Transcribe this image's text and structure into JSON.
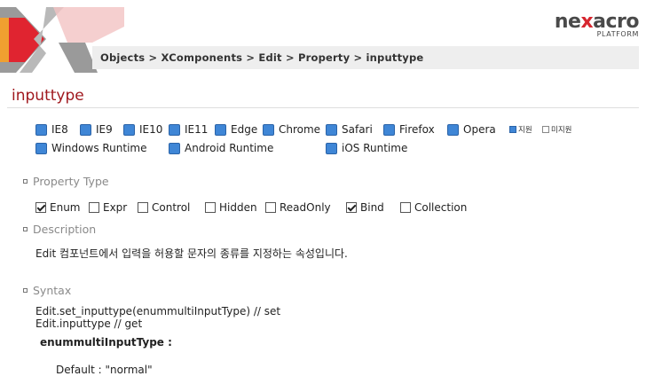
{
  "header": {
    "breadcrumb": "Objects > XComponents > Edit > Property > inputtype",
    "brand_pre": "ne",
    "brand_x": "x",
    "brand_post": "acro",
    "brand_sub": "PLATFORM"
  },
  "page": {
    "title": "inputtype"
  },
  "environments": {
    "row1": [
      "IE8",
      "IE9",
      "IE10",
      "IE11",
      "Edge",
      "Chrome",
      "Safari",
      "Firefox",
      "Opera"
    ],
    "row2": [
      "Windows Runtime",
      "Android Runtime",
      "iOS Runtime"
    ],
    "legend_supported": "지원",
    "legend_unsupported": "미지원"
  },
  "sections": {
    "property_type": "Property Type",
    "description": "Description",
    "syntax": "Syntax"
  },
  "property_types": [
    {
      "label": "Enum",
      "checked": true
    },
    {
      "label": "Expr",
      "checked": false
    },
    {
      "label": "Control",
      "checked": false
    },
    {
      "label": "Hidden",
      "checked": false
    },
    {
      "label": "ReadOnly",
      "checked": false
    },
    {
      "label": "Bind",
      "checked": true
    },
    {
      "label": "Collection",
      "checked": false
    }
  ],
  "description_text": "Edit 컴포넌트에서 입력을 허용할 문자의 종류를 지정하는 속성입니다.",
  "syntax": {
    "line1": "Edit.set_inputtype(enummultiInputType) // set",
    "line2": "Edit.inputtype // get",
    "param": "enummultiInputType :",
    "default": "Default : \"normal\""
  },
  "colors": {
    "accent_red": "#a0181e",
    "check_blue": "#3f86d6",
    "logo_red": "#d6262f"
  }
}
